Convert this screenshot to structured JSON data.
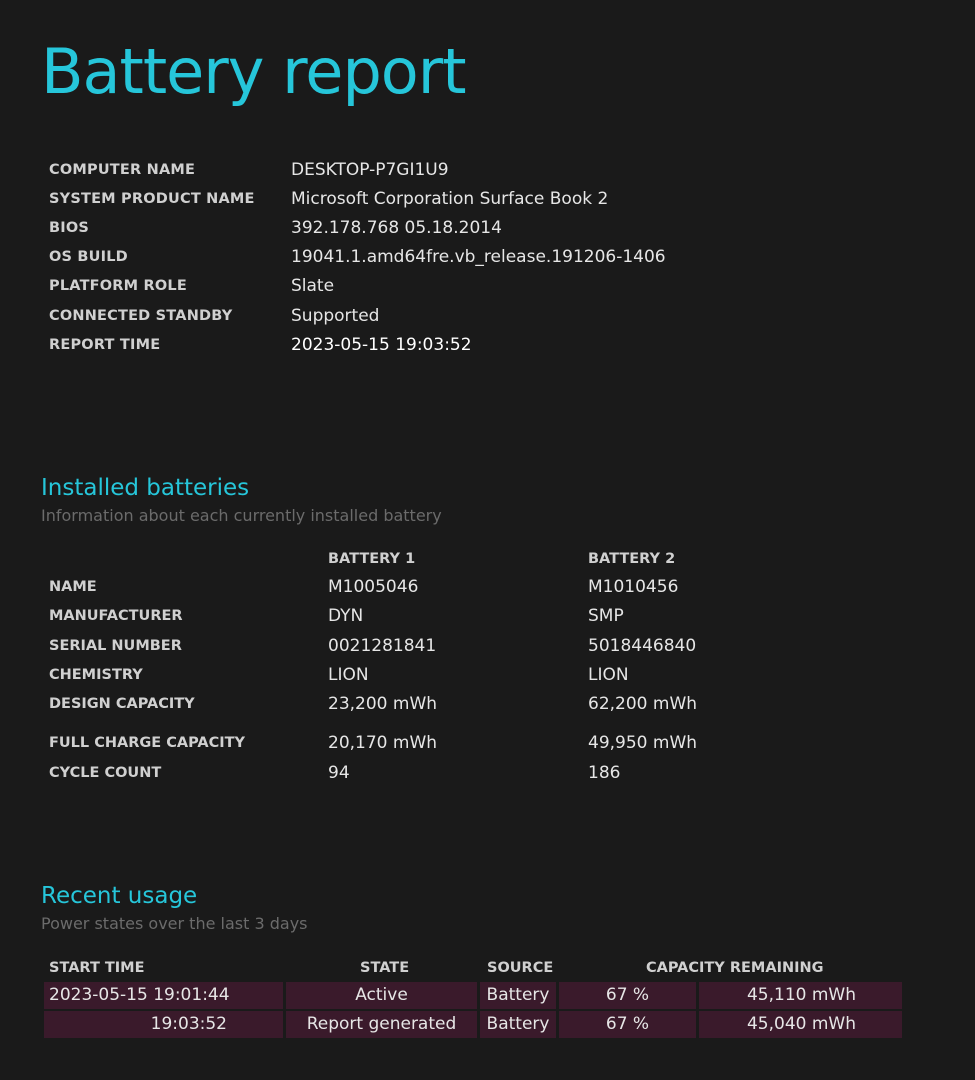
{
  "title": "Battery report",
  "system_info": [
    {
      "label": "COMPUTER NAME",
      "value": "DESKTOP-P7GI1U9"
    },
    {
      "label": "SYSTEM PRODUCT NAME",
      "value": "Microsoft Corporation Surface Book 2"
    },
    {
      "label": "BIOS",
      "value": "392.178.768 05.18.2014"
    },
    {
      "label": "OS BUILD",
      "value": "19041.1.amd64fre.vb_release.191206-1406"
    },
    {
      "label": "PLATFORM ROLE",
      "value": "Slate"
    },
    {
      "label": "CONNECTED STANDBY",
      "value": "Supported"
    },
    {
      "label": "REPORT TIME",
      "value": "2023-05-15  19:03:52"
    }
  ],
  "installed_batteries": {
    "title": "Installed batteries",
    "subtitle": "Information about each currently installed battery",
    "headers": [
      "BATTERY 1",
      "BATTERY 2"
    ],
    "rows": [
      {
        "label": "NAME",
        "b1": "M1005046",
        "b2": "M1010456"
      },
      {
        "label": "MANUFACTURER",
        "b1": "DYN",
        "b2": "SMP"
      },
      {
        "label": "SERIAL NUMBER",
        "b1": "0021281841",
        "b2": "5018446840"
      },
      {
        "label": "CHEMISTRY",
        "b1": "LION",
        "b2": "LION"
      },
      {
        "label": "DESIGN CAPACITY",
        "b1": "23,200 mWh",
        "b2": "62,200 mWh"
      },
      {
        "label": "FULL CHARGE CAPACITY",
        "b1": "20,170 mWh",
        "b2": "49,950 mWh"
      },
      {
        "label": "CYCLE COUNT",
        "b1": "94",
        "b2": "186"
      }
    ]
  },
  "recent_usage": {
    "title": "Recent usage",
    "subtitle": "Power states over the last 3 days",
    "headers": {
      "start_time": "START TIME",
      "state": "STATE",
      "source": "SOURCE",
      "capacity": "CAPACITY REMAINING"
    },
    "rows": [
      {
        "start_time": "2023-05-15  19:01:44",
        "state": "Active",
        "source": "Battery",
        "percent": "67 %",
        "mwh": "45,110 mWh"
      },
      {
        "start_time": "19:03:52",
        "state": "Report generated",
        "source": "Battery",
        "percent": "67 %",
        "mwh": "45,040 mWh"
      }
    ]
  },
  "colors": {
    "background": "#1a1a1a",
    "accent": "#26c6da",
    "row_highlight": "#3a1a2b"
  }
}
